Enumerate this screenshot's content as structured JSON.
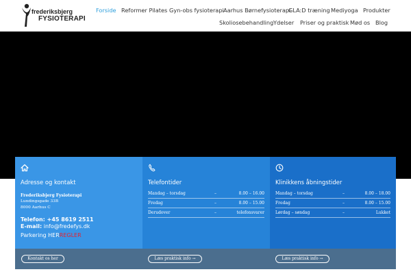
{
  "logo": {
    "line1": "frederiksbjerg",
    "line2": "FYSIOTERAPI"
  },
  "nav": {
    "row1": [
      "Forside",
      "Reformer Pilates",
      "Gyn-obs fysioterapi",
      "Aarhus Børnefysioterapi",
      "GLA:D træning",
      "Mediyoga",
      "Produkter"
    ],
    "row2": [
      "Skoliosebehandling",
      "Ydelser",
      "Priser og praktisk",
      "Mød os",
      "Blog"
    ],
    "active": "Forside"
  },
  "panels": {
    "address": {
      "icon": "home-icon",
      "title": "Adresse og kontakt",
      "name": "Frederiksbjerg Fysioterapi",
      "street": "Lundingsgade 33B",
      "city": "8000 Aarhus C",
      "phone": "Telefon: +45 8619 2511",
      "email_label": "E-mail:",
      "email": "info@fredefys.dk",
      "parking_text": "Parkering HER",
      "parking_rules": "REGLER",
      "button": "Kontakt os her"
    },
    "phone_hours": {
      "icon": "phone-icon",
      "title": "Telefontider",
      "rows": [
        {
          "day": "Mandag – torsdag",
          "sep": "–",
          "time": "8.00 – 16.00"
        },
        {
          "day": "Fredag",
          "sep": "–",
          "time": "8.00 – 15.00"
        },
        {
          "day": "Derudover",
          "sep": "–",
          "time": "telefonsvarer"
        }
      ],
      "button": "Læs praktisk info →"
    },
    "opening_hours": {
      "icon": "clock-icon",
      "title": "Klinikkens åbningstider",
      "rows": [
        {
          "day": "Mandag – torsdag",
          "sep": "–",
          "time": "8.00 – 18.00"
        },
        {
          "day": "Fredag",
          "sep": "–",
          "time": "8.00 – 15.00"
        },
        {
          "day": "Lørdag – søndag",
          "sep": "–",
          "time": "Lukket"
        }
      ],
      "button": "Læs praktisk info →"
    }
  },
  "colors": {
    "accent": "#2e9fdc",
    "panel1": "#3a96e6",
    "panel2": "#2683d8",
    "panel3": "#1a6fc9",
    "footer": "#4b6e8e",
    "red": "#e8202f"
  }
}
